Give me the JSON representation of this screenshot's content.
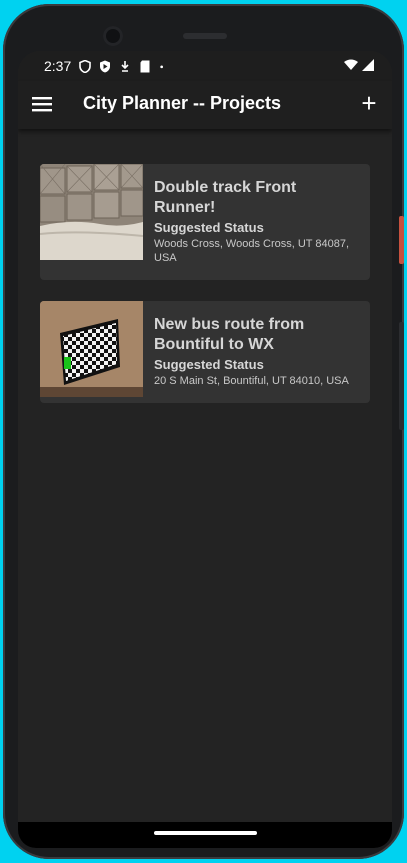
{
  "status_bar": {
    "time": "2:37",
    "icons": [
      "shield-icon",
      "play-store-icon",
      "download-icon",
      "sd-card-icon",
      "dot-icon"
    ],
    "right_icons": [
      "wifi-icon",
      "signal-icon"
    ]
  },
  "app_bar": {
    "title": "City Planner -- Projects",
    "menu_icon": "hamburger-menu-icon",
    "add_label": "+"
  },
  "projects": [
    {
      "title": "Double track Front Runner!",
      "status": "Suggested Status",
      "address": "Woods Cross, Woods Cross, UT 84087, USA",
      "thumbnail": "padded-wall-photo"
    },
    {
      "title": "New bus route from Bountiful to WX",
      "status": "Suggested Status",
      "address": "20 S Main St, Bountiful, UT 84010, USA",
      "thumbnail": "checkerboard-tv-photo"
    }
  ],
  "colors": {
    "background": "#232323",
    "card": "#333333",
    "app_bar": "#1f1f1f",
    "text": "#d6d6d6"
  }
}
